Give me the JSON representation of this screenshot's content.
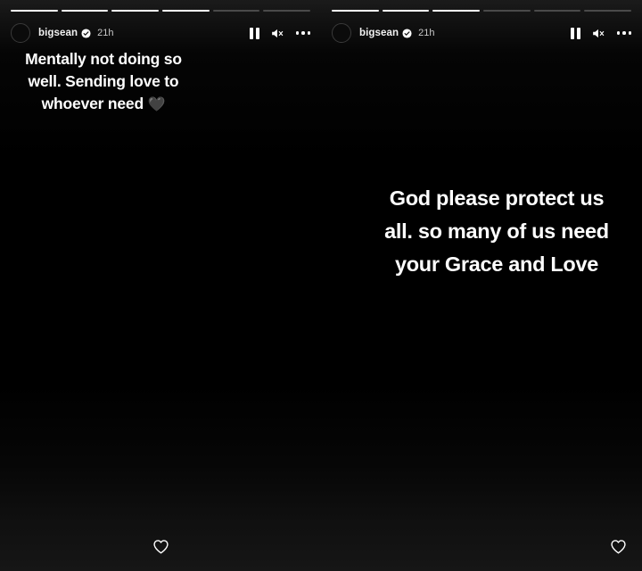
{
  "app": {
    "name": "instagram-stories",
    "background_color": "#000000",
    "accent_color": "#ffffff"
  },
  "stories": [
    {
      "id": "story-left",
      "progress": {
        "total_segments": 6,
        "filled_segments": 4
      },
      "header": {
        "avatar_label": "bigsean profile picture",
        "username": "bigsean",
        "verified": true,
        "verified_icon": "verified-badge-icon",
        "timestamp": "21h",
        "controls": [
          {
            "name": "pause-button",
            "icon": "pause-icon",
            "label": "Pause"
          },
          {
            "name": "mute-button",
            "icon": "speaker-muted-icon",
            "label": "Unmute"
          },
          {
            "name": "more-options-button",
            "icon": "more-horizontal-icon",
            "label": "More options"
          }
        ]
      },
      "caption": "Mentally not doing so\nwell. Sending love to\nwhoever need ",
      "caption_emoji": "🖤",
      "like": {
        "icon": "heart-outline-icon",
        "label": "Like",
        "liked": false
      }
    },
    {
      "id": "story-right",
      "progress": {
        "total_segments": 6,
        "filled_segments": 3
      },
      "header": {
        "avatar_label": "bigsean profile picture",
        "username": "bigsean",
        "verified": true,
        "verified_icon": "verified-badge-icon",
        "timestamp": "21h",
        "controls": [
          {
            "name": "pause-button",
            "icon": "pause-icon",
            "label": "Pause"
          },
          {
            "name": "mute-button",
            "icon": "speaker-muted-icon",
            "label": "Unmute"
          },
          {
            "name": "more-options-button",
            "icon": "more-horizontal-icon",
            "label": "More options"
          }
        ]
      },
      "caption": "God please protect us\nall. so many of us need\nyour Grace and Love",
      "caption_emoji": "",
      "like": {
        "icon": "heart-outline-icon",
        "label": "Like",
        "liked": false
      }
    }
  ]
}
